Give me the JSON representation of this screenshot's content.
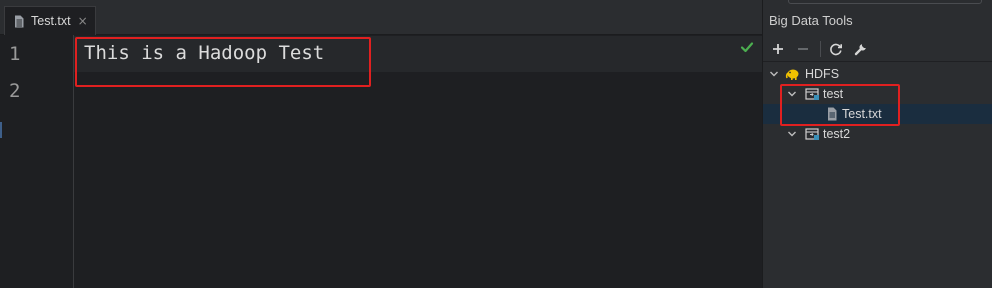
{
  "editor": {
    "tab": {
      "label": "Test.txt",
      "close": "×"
    },
    "lines": [
      {
        "number": "1",
        "text": "This is a Hadoop Test"
      },
      {
        "number": "2",
        "text": ""
      }
    ],
    "status_icon": "checkmark-icon",
    "highlight_color": "#e02020"
  },
  "panel": {
    "title": "Big Data Tools",
    "toolbar": {
      "add": "+",
      "remove": "−",
      "icons": [
        "plus-icon",
        "minus-icon",
        "refresh-icon",
        "wrench-icon"
      ]
    },
    "tree": [
      {
        "label": "HDFS",
        "icon": "hadoop-elephant-icon",
        "expanded": true
      },
      {
        "label": "test",
        "icon": "folder-icon",
        "expanded": true
      },
      {
        "label": "Test.txt",
        "icon": "file-icon",
        "selected": true
      },
      {
        "label": "test2",
        "icon": "folder-icon",
        "expanded": true
      }
    ]
  },
  "colors": {
    "background": "#1e1f22",
    "panel": "#2b2d30",
    "selection": "#1a2d3f",
    "check": "#4caf50",
    "hadoop_yellow": "#f2c200",
    "folder_teal": "#3a8fb7"
  }
}
